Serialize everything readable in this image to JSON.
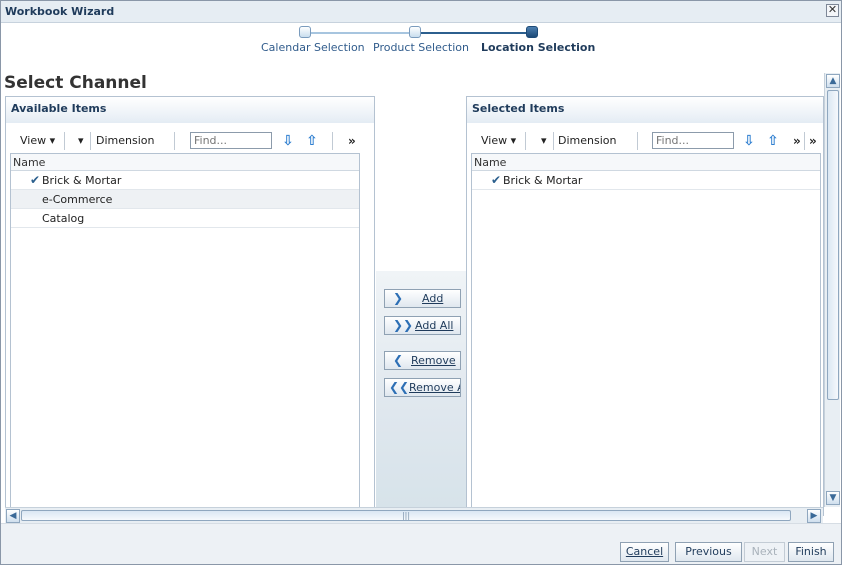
{
  "window": {
    "title": "Workbook Wizard",
    "close_glyph": "✕"
  },
  "train": {
    "steps": [
      {
        "label": "Calendar Selection",
        "current": false
      },
      {
        "label": "Product Selection",
        "current": false
      },
      {
        "label": "Location Selection",
        "current": true
      }
    ]
  },
  "page": {
    "title": "Select Channel"
  },
  "available": {
    "header": "Available Items",
    "toolbar": {
      "view": "View ▾",
      "dimension": "Dimension",
      "find_placeholder": "Find...",
      "more": "»"
    },
    "column": "Name",
    "rows": [
      {
        "label": "Brick & Mortar",
        "checked": true
      },
      {
        "label": "e-Commerce",
        "checked": false
      },
      {
        "label": "Catalog",
        "checked": false
      }
    ]
  },
  "selected": {
    "header": "Selected Items",
    "toolbar": {
      "view": "View ▾",
      "dimension": "Dimension",
      "find_placeholder": "Find...",
      "more": "»"
    },
    "column": "Name",
    "rows": [
      {
        "label": "Brick & Mortar",
        "checked": true
      }
    ]
  },
  "shuttle": {
    "add": "Add",
    "add_all": "Add All",
    "remove": "Remove",
    "remove_all": "Remove A"
  },
  "footer": {
    "cancel": "Cancel",
    "previous": "Previous",
    "next": "Next",
    "finish": "Finish"
  },
  "icons": {
    "down_arrow": "down-arrow-icon",
    "up_arrow": "up-arrow-icon",
    "check": "check-icon"
  }
}
